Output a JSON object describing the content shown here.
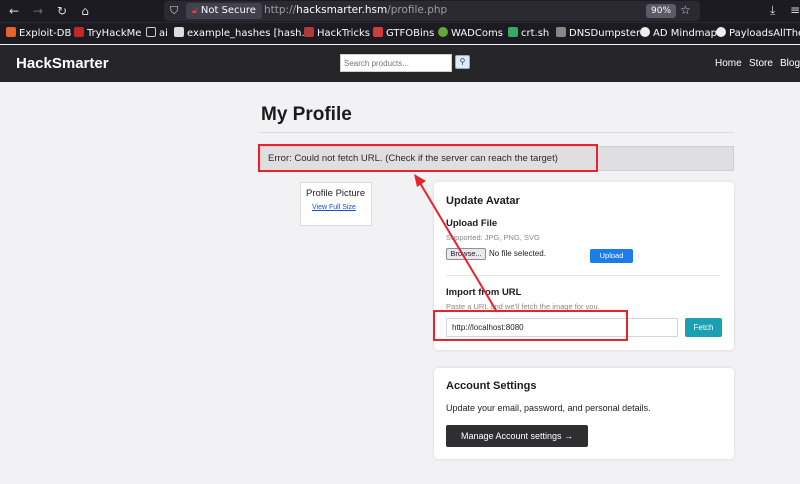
{
  "browser": {
    "not_secure": "Not Secure",
    "url_scheme": "http://",
    "url_host": "hacksmarter.hsm",
    "url_path": "/profile.php",
    "zoom": "90%",
    "bookmarks": [
      "Exploit-DB",
      "TryHackMe",
      "ai",
      "example_hashes [hash...",
      "HackTricks",
      "GTFOBins",
      "WADComs",
      "crt.sh",
      "DNSDumpster",
      "AD Mindmap",
      "PayloadsAllTheT"
    ]
  },
  "site": {
    "brand": "HackSmarter",
    "search_placeholder": "Search products...",
    "nav": [
      "Home",
      "Store",
      "Blog"
    ]
  },
  "main": {
    "title": "My Profile",
    "error": "Error: Could not fetch URL. (Check if the server can reach the target)",
    "profile_picture": "Profile Picture",
    "view_full_size": "View Full Size"
  },
  "avatar": {
    "heading": "Update Avatar",
    "upload_heading": "Upload File",
    "supported": "Supported: JPG, PNG, SVG",
    "browse": "Browse...",
    "no_file": "No file selected.",
    "upload_button": "Upload",
    "import_heading": "Import from URL",
    "import_hint": "Paste a URL and we'll fetch the image for you.",
    "url_value": "http://localhost:8080",
    "fetch_button": "Fetch"
  },
  "settings": {
    "heading": "Account Settings",
    "description": "Update your email, password, and personal details.",
    "button": "Manage Account settings →"
  },
  "colors": {
    "annotation": "#e8232d",
    "upload": "#1a7de8",
    "fetch": "#1ba0b3",
    "header": "#262628"
  }
}
